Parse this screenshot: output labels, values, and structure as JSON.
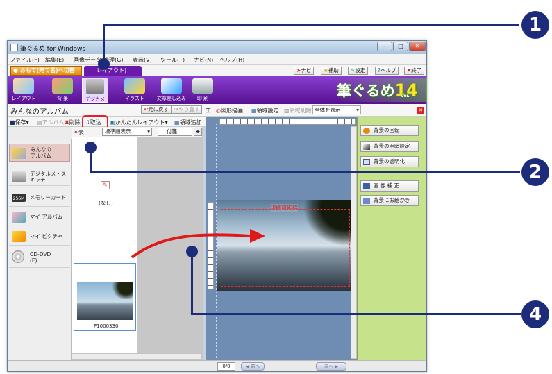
{
  "window": {
    "title": "筆ぐるめ for Windows",
    "btn_min": "–",
    "btn_max": "□",
    "btn_close": "✕"
  },
  "menu": [
    "ファイル(F)",
    "編集(E)",
    "画像データ",
    "管理(G)",
    "表示(V)",
    "ツール(T)",
    "ナビ(N)",
    "ヘルプ(H)"
  ],
  "tabs": {
    "omote": "おもて(宛て名)へ切替",
    "ura": "レイアウト)"
  },
  "header_buttons": [
    "ナビ",
    "補助",
    "設定",
    "ヘルプ",
    "終了"
  ],
  "ribbon": {
    "tools": [
      "レイアウト",
      "背 景",
      "デジカメ",
      "イラスト",
      "文章差し込み",
      "印 刷"
    ],
    "logo_text": "筆ぐるめ",
    "logo_num": "14",
    "logo_ver": "Ver."
  },
  "album": {
    "title": "みんなのアルバム",
    "toolbar": [
      "保存",
      "アルバム",
      "削除",
      "取込",
      "かんたんレイアウト",
      "領域追加"
    ],
    "display_label": "表",
    "sort_select": "標準順表示",
    "date_select": "付箋",
    "none_label": "(なし)",
    "photo_name": "P1000330"
  },
  "edit_toolbar": {
    "undo": "元に戻す",
    "redo": "やり直す",
    "kakou": "工",
    "shape": "図形描画",
    "region": "領域設定",
    "region_del": "領域削除",
    "zoom": "全体を表示"
  },
  "left_tabs": [
    "みんなの\nアルバム",
    "デジタルメ・スキャナ",
    "メモリーカード",
    "マイ アルバム",
    "マイ ピクチャ",
    "CD-DVD\n(E)"
  ],
  "memory_badge": "256M",
  "canvas": {
    "print_label": "印刷可能枠"
  },
  "right_panel": [
    "背景の回転",
    "背景の明暗設定",
    "背景の透明化",
    "画 像 補 正",
    "背景にお絵かき"
  ],
  "status": {
    "page": "0/0",
    "prev": "◀ 前へ",
    "next": "次へ ▶"
  },
  "callouts": [
    "1",
    "2",
    "4"
  ],
  "colors": {
    "callout": "#1d2c7a",
    "ribbon": "#6a1aa8",
    "highlight": "#e0202a",
    "arrow": "#e01818",
    "right_panel": "#c6e28a"
  }
}
